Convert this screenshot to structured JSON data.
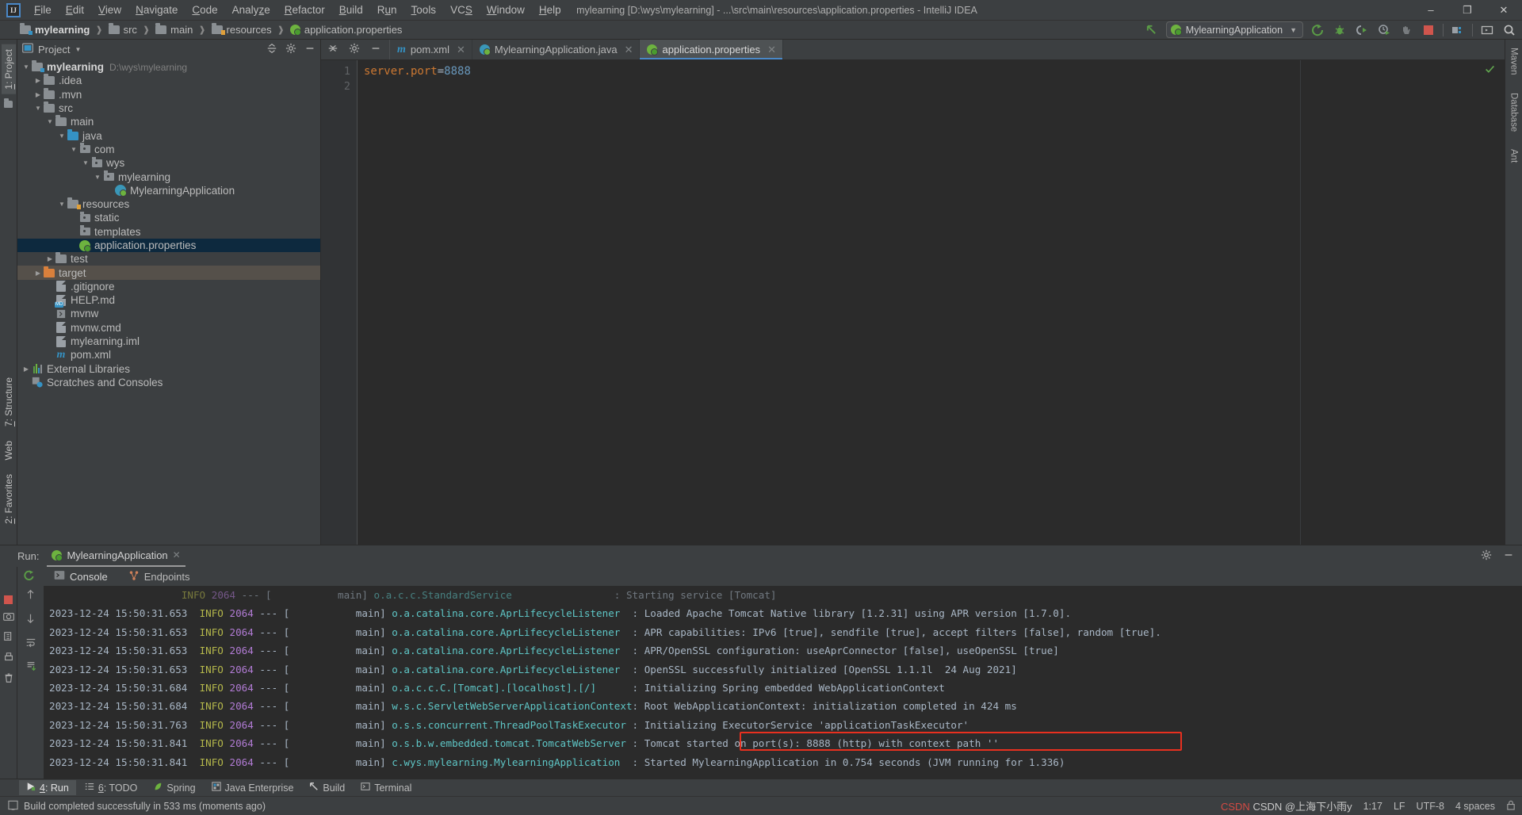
{
  "window": {
    "title": "mylearning [D:\\wys\\mylearning] - ...\\src\\main\\resources\\application.properties - IntelliJ IDEA",
    "logo": "IJ",
    "minimize": "–",
    "maximize": "❐",
    "close": "✕"
  },
  "menubar": [
    {
      "label": "File",
      "name": "menu-file"
    },
    {
      "label": "Edit",
      "name": "menu-edit"
    },
    {
      "label": "View",
      "name": "menu-view"
    },
    {
      "label": "Navigate",
      "name": "menu-navigate"
    },
    {
      "label": "Code",
      "name": "menu-code"
    },
    {
      "label": "Analyze",
      "name": "menu-analyze"
    },
    {
      "label": "Refactor",
      "name": "menu-refactor"
    },
    {
      "label": "Build",
      "name": "menu-build"
    },
    {
      "label": "Run",
      "name": "menu-run"
    },
    {
      "label": "Tools",
      "name": "menu-tools"
    },
    {
      "label": "VCS",
      "name": "menu-vcs"
    },
    {
      "label": "Window",
      "name": "menu-window"
    },
    {
      "label": "Help",
      "name": "menu-help"
    }
  ],
  "breadcrumb": [
    {
      "label": "mylearning",
      "icon": "module-folder-icon",
      "bold": true
    },
    {
      "label": "src",
      "icon": "folder-icon",
      "bold": false
    },
    {
      "label": "main",
      "icon": "folder-icon",
      "bold": false
    },
    {
      "label": "resources",
      "icon": "resources-folder-icon",
      "bold": false
    },
    {
      "label": "application.properties",
      "icon": "spring-properties-icon",
      "bold": false
    }
  ],
  "toolbar": {
    "back_icon": "back-arrow-icon",
    "run_config": "MylearningApplication",
    "run_config_icon": "spring-boot-icon",
    "dropdown_icon": "chevron-down-icon",
    "buttons": [
      {
        "name": "run-button",
        "icon": "run-icon"
      },
      {
        "name": "debug-button",
        "icon": "debug-bug-icon"
      },
      {
        "name": "run-with-coverage-button",
        "icon": "coverage-icon"
      },
      {
        "name": "profile-button",
        "icon": "profiler-clock-icon"
      },
      {
        "name": "attach-process-button",
        "icon": "attach-hand-icon"
      },
      {
        "name": "stop-button",
        "icon": "stop-square-icon"
      },
      {
        "name": "project-structure-button",
        "icon": "project-structure-icon"
      },
      {
        "name": "open-terminal-button",
        "icon": "terminal-icon"
      },
      {
        "name": "search-everywhere-button",
        "icon": "search-icon"
      }
    ]
  },
  "left_tool_strip": {
    "project_tab": "1: Project",
    "structure_tab": "7: Structure",
    "favorites_tab": "2: Favorites",
    "web_tab": "Web"
  },
  "right_tool_strip": {
    "maven_tab": "Maven",
    "database_tab": "Database",
    "ant_tab": "Ant"
  },
  "project_panel": {
    "title": "Project",
    "dropdown_icon": "chevron-down-icon",
    "collapse_icon": "collapse-all-icon",
    "settings_icon": "gear-icon",
    "hide_icon": "hide-icon",
    "tree": [
      {
        "label": "mylearning",
        "sub": "D:\\wys\\mylearning",
        "indent": 0,
        "arrow": "down",
        "icon": "module-folder-icon",
        "bold": true,
        "state": ""
      },
      {
        "label": ".idea",
        "sub": "",
        "indent": 1,
        "arrow": "right",
        "icon": "folder-icon",
        "bold": false,
        "state": ""
      },
      {
        "label": ".mvn",
        "sub": "",
        "indent": 1,
        "arrow": "right",
        "icon": "folder-icon",
        "bold": false,
        "state": ""
      },
      {
        "label": "src",
        "sub": "",
        "indent": 1,
        "arrow": "down",
        "icon": "folder-icon",
        "bold": false,
        "state": ""
      },
      {
        "label": "main",
        "sub": "",
        "indent": 2,
        "arrow": "down",
        "icon": "folder-icon",
        "bold": false,
        "state": ""
      },
      {
        "label": "java",
        "sub": "",
        "indent": 3,
        "arrow": "down",
        "icon": "source-folder-icon",
        "bold": false,
        "state": ""
      },
      {
        "label": "com",
        "sub": "",
        "indent": 4,
        "arrow": "down",
        "icon": "package-icon",
        "bold": false,
        "state": ""
      },
      {
        "label": "wys",
        "sub": "",
        "indent": 5,
        "arrow": "down",
        "icon": "package-icon",
        "bold": false,
        "state": ""
      },
      {
        "label": "mylearning",
        "sub": "",
        "indent": 6,
        "arrow": "down",
        "icon": "package-icon",
        "bold": false,
        "state": ""
      },
      {
        "label": "MylearningApplication",
        "sub": "",
        "indent": 7,
        "arrow": "none",
        "icon": "spring-boot-class-icon",
        "bold": false,
        "state": ""
      },
      {
        "label": "resources",
        "sub": "",
        "indent": 3,
        "arrow": "down",
        "icon": "resources-folder-icon",
        "bold": false,
        "state": ""
      },
      {
        "label": "static",
        "sub": "",
        "indent": 4,
        "arrow": "none",
        "icon": "package-icon",
        "bold": false,
        "state": ""
      },
      {
        "label": "templates",
        "sub": "",
        "indent": 4,
        "arrow": "none",
        "icon": "package-icon",
        "bold": false,
        "state": ""
      },
      {
        "label": "application.properties",
        "sub": "",
        "indent": 4,
        "arrow": "none",
        "icon": "spring-properties-icon",
        "bold": false,
        "state": "selected"
      },
      {
        "label": "test",
        "sub": "",
        "indent": 2,
        "arrow": "right",
        "icon": "folder-icon",
        "bold": false,
        "state": ""
      },
      {
        "label": "target",
        "sub": "",
        "indent": 1,
        "arrow": "right",
        "icon": "target-folder-icon",
        "bold": false,
        "state": "highlight"
      },
      {
        "label": ".gitignore",
        "sub": "",
        "indent": 2,
        "arrow": "none",
        "icon": "gitignore-file-icon",
        "bold": false,
        "state": ""
      },
      {
        "label": "HELP.md",
        "sub": "",
        "indent": 2,
        "arrow": "none",
        "icon": "markdown-file-icon",
        "bold": false,
        "state": ""
      },
      {
        "label": "mvnw",
        "sub": "",
        "indent": 2,
        "arrow": "none",
        "icon": "script-file-icon",
        "bold": false,
        "state": ""
      },
      {
        "label": "mvnw.cmd",
        "sub": "",
        "indent": 2,
        "arrow": "none",
        "icon": "cmd-file-icon",
        "bold": false,
        "state": ""
      },
      {
        "label": "mylearning.iml",
        "sub": "",
        "indent": 2,
        "arrow": "none",
        "icon": "iml-file-icon",
        "bold": false,
        "state": ""
      },
      {
        "label": "pom.xml",
        "sub": "",
        "indent": 2,
        "arrow": "none",
        "icon": "maven-pom-icon",
        "bold": false,
        "state": ""
      },
      {
        "label": "External Libraries",
        "sub": "",
        "indent": 0,
        "arrow": "right",
        "icon": "external-libraries-icon",
        "bold": false,
        "state": ""
      },
      {
        "label": "Scratches and Consoles",
        "sub": "",
        "indent": 0,
        "arrow": "none",
        "icon": "scratches-icon",
        "bold": false,
        "state": ""
      }
    ]
  },
  "editor": {
    "actions": {
      "collapse_icon": "collapse-all-icon",
      "settings_icon": "gear-icon",
      "hide_icon": "hide-icon"
    },
    "tabs": [
      {
        "label": "pom.xml",
        "icon": "maven-pom-icon",
        "active": false,
        "close": "✕"
      },
      {
        "label": "MylearningApplication.java",
        "icon": "spring-boot-class-icon",
        "active": false,
        "close": "✕"
      },
      {
        "label": "application.properties",
        "icon": "spring-properties-icon",
        "active": true,
        "close": "✕"
      }
    ],
    "line_numbers": [
      "1",
      "2"
    ],
    "code": {
      "key": "server.port",
      "eq": "=",
      "value": "8888"
    },
    "inspection_status_icon": "ok-check-icon"
  },
  "run_window": {
    "label": "Run:",
    "tab": "MylearningApplication",
    "tab_icon": "spring-boot-icon",
    "tab_close": "✕",
    "settings_icon": "gear-icon",
    "hide_icon": "hide-icon",
    "subtabs": [
      {
        "label": "Console",
        "icon": "console-icon",
        "active": true
      },
      {
        "label": "Endpoints",
        "icon": "endpoints-icon",
        "active": false
      }
    ],
    "side_actions": [
      {
        "name": "rerun-button",
        "icon": "rerun-icon"
      },
      {
        "name": "stop-button",
        "icon": "stop-square-icon"
      },
      {
        "name": "camera-button",
        "icon": "camera-icon"
      },
      {
        "name": "thread-dump-button",
        "icon": "thread-dump-icon"
      },
      {
        "name": "print-button",
        "icon": "print-icon"
      },
      {
        "name": "trash-button",
        "icon": "trash-icon"
      }
    ],
    "console_gutter": [
      {
        "name": "scroll-up-button",
        "icon": "arrow-up-icon"
      },
      {
        "name": "scroll-down-button",
        "icon": "arrow-down-icon"
      },
      {
        "name": "soft-wrap-button",
        "icon": "soft-wrap-icon"
      },
      {
        "name": "scroll-to-end-button",
        "icon": "scroll-to-end-icon"
      }
    ],
    "highlight_color": "#e8301f",
    "console_lines": [
      {
        "ts": "",
        "level": "",
        "pid": "",
        "thread": "",
        "cls": "",
        "msg": "",
        "clipped": true,
        "raw_clipped": ": Starting service [Tomcat]"
      },
      {
        "ts": "2023-12-24 15:50:31.653",
        "level": "INFO",
        "pid": "2064",
        "thread": "main",
        "cls": "o.a.catalina.core.AprLifecycleListener",
        "msg": ": Loaded Apache Tomcat Native library [1.2.31] using APR version [1.7.0]."
      },
      {
        "ts": "2023-12-24 15:50:31.653",
        "level": "INFO",
        "pid": "2064",
        "thread": "main",
        "cls": "o.a.catalina.core.AprLifecycleListener",
        "msg": ": APR capabilities: IPv6 [true], sendfile [true], accept filters [false], random [true]."
      },
      {
        "ts": "2023-12-24 15:50:31.653",
        "level": "INFO",
        "pid": "2064",
        "thread": "main",
        "cls": "o.a.catalina.core.AprLifecycleListener",
        "msg": ": APR/OpenSSL configuration: useAprConnector [false], useOpenSSL [true]"
      },
      {
        "ts": "2023-12-24 15:50:31.653",
        "level": "INFO",
        "pid": "2064",
        "thread": "main",
        "cls": "o.a.catalina.core.AprLifecycleListener",
        "msg": ": OpenSSL successfully initialized [OpenSSL 1.1.1l  24 Aug 2021]"
      },
      {
        "ts": "2023-12-24 15:50:31.684",
        "level": "INFO",
        "pid": "2064",
        "thread": "main",
        "cls": "o.a.c.c.C.[Tomcat].[localhost].[/]",
        "msg": ": Initializing Spring embedded WebApplicationContext"
      },
      {
        "ts": "2023-12-24 15:50:31.684",
        "level": "INFO",
        "pid": "2064",
        "thread": "main",
        "cls": "w.s.c.ServletWebServerApplicationContext",
        "msg": ": Root WebApplicationContext: initialization completed in 424 ms"
      },
      {
        "ts": "2023-12-24 15:50:31.763",
        "level": "INFO",
        "pid": "2064",
        "thread": "main",
        "cls": "o.s.s.concurrent.ThreadPoolTaskExecutor",
        "msg": ": Initializing ExecutorService 'applicationTaskExecutor'"
      },
      {
        "ts": "2023-12-24 15:50:31.841",
        "level": "INFO",
        "pid": "2064",
        "thread": "main",
        "cls": "o.s.b.w.embedded.tomcat.TomcatWebServer",
        "msg": ": Tomcat started on port(s): 8888 (http) with context path ''",
        "highlighted": true
      },
      {
        "ts": "2023-12-24 15:50:31.841",
        "level": "INFO",
        "pid": "2064",
        "thread": "main",
        "cls": "c.wys.mylearning.MylearningApplication",
        "msg": ": Started MylearningApplication in 0.754 seconds (JVM running for 1.336)"
      }
    ]
  },
  "bottom_tabs": [
    {
      "label": "4: Run",
      "underline": "4",
      "icon": "run-icon",
      "active": true
    },
    {
      "label": "6: TODO",
      "underline": "6",
      "icon": "todo-icon",
      "active": false
    },
    {
      "label": "Spring",
      "underline": "",
      "icon": "spring-leaf-icon",
      "active": false
    },
    {
      "label": "Java Enterprise",
      "underline": "",
      "icon": "java-enterprise-icon",
      "active": false
    },
    {
      "label": "Build",
      "underline": "",
      "icon": "build-hammer-icon",
      "active": false
    },
    {
      "label": "Terminal",
      "underline": "",
      "icon": "terminal-icon",
      "active": false
    }
  ],
  "status_bar": {
    "icon": "event-log-icon",
    "message": "Build completed successfully in 533 ms (moments ago)",
    "caret": "1:17",
    "line_sep": "LF",
    "encoding": "UTF-8",
    "indent": "4 spaces",
    "lock_icon": "lock-icon"
  },
  "watermark": {
    "line1": "CSDN @上海下小雨y"
  }
}
